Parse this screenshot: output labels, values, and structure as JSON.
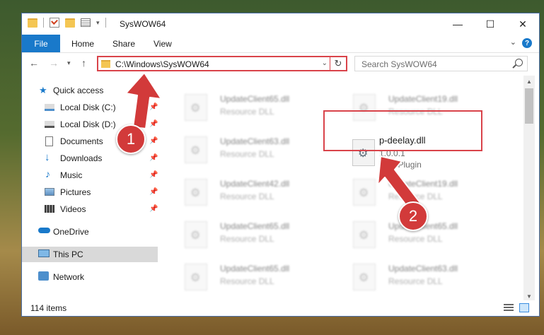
{
  "window": {
    "title": "SysWOW64"
  },
  "ribbon": {
    "tabs": [
      "File",
      "Home",
      "Share",
      "View"
    ],
    "help": "?"
  },
  "address": {
    "path": "C:\\Windows\\SysWOW64"
  },
  "search": {
    "placeholder": "Search SysWOW64"
  },
  "nav": {
    "quick_access": "Quick access",
    "items": [
      "Local Disk (C:)",
      "Local Disk (D:)",
      "Documents",
      "Downloads",
      "Music",
      "Pictures",
      "Videos"
    ],
    "onedrive": "OneDrive",
    "this_pc": "This PC",
    "network": "Network"
  },
  "files": [
    {
      "name": "UpdateClient65.dll",
      "type": "Resource DLL"
    },
    {
      "name": "UpdateClient19.dll",
      "type": "Resource DLL"
    },
    {
      "name": "UpdateClient63.dll",
      "type": "Resource DLL"
    },
    {
      "name": "p-deelay.dll",
      "version": "1.0.0.1",
      "type": "VST Plugin"
    },
    {
      "name": "UpdateClient42.dll",
      "type": "Resource DLL"
    },
    {
      "name": "UpdateClient19.dll",
      "type": "Resource DLL"
    },
    {
      "name": "UpdateClient65.dll",
      "type": "Resource DLL"
    },
    {
      "name": "UpdateClient65.dll",
      "type": "Resource DLL"
    },
    {
      "name": "UpdateClient65.dll",
      "type": "Resource DLL"
    },
    {
      "name": "UpdateClient63.dll",
      "type": "Resource DLL"
    }
  ],
  "status": {
    "items": "114 items"
  },
  "annotations": {
    "step1": "1",
    "step2": "2"
  },
  "colors": {
    "accent": "#1979ca",
    "highlight": "#d9434a",
    "badge": "#d23a3a"
  }
}
